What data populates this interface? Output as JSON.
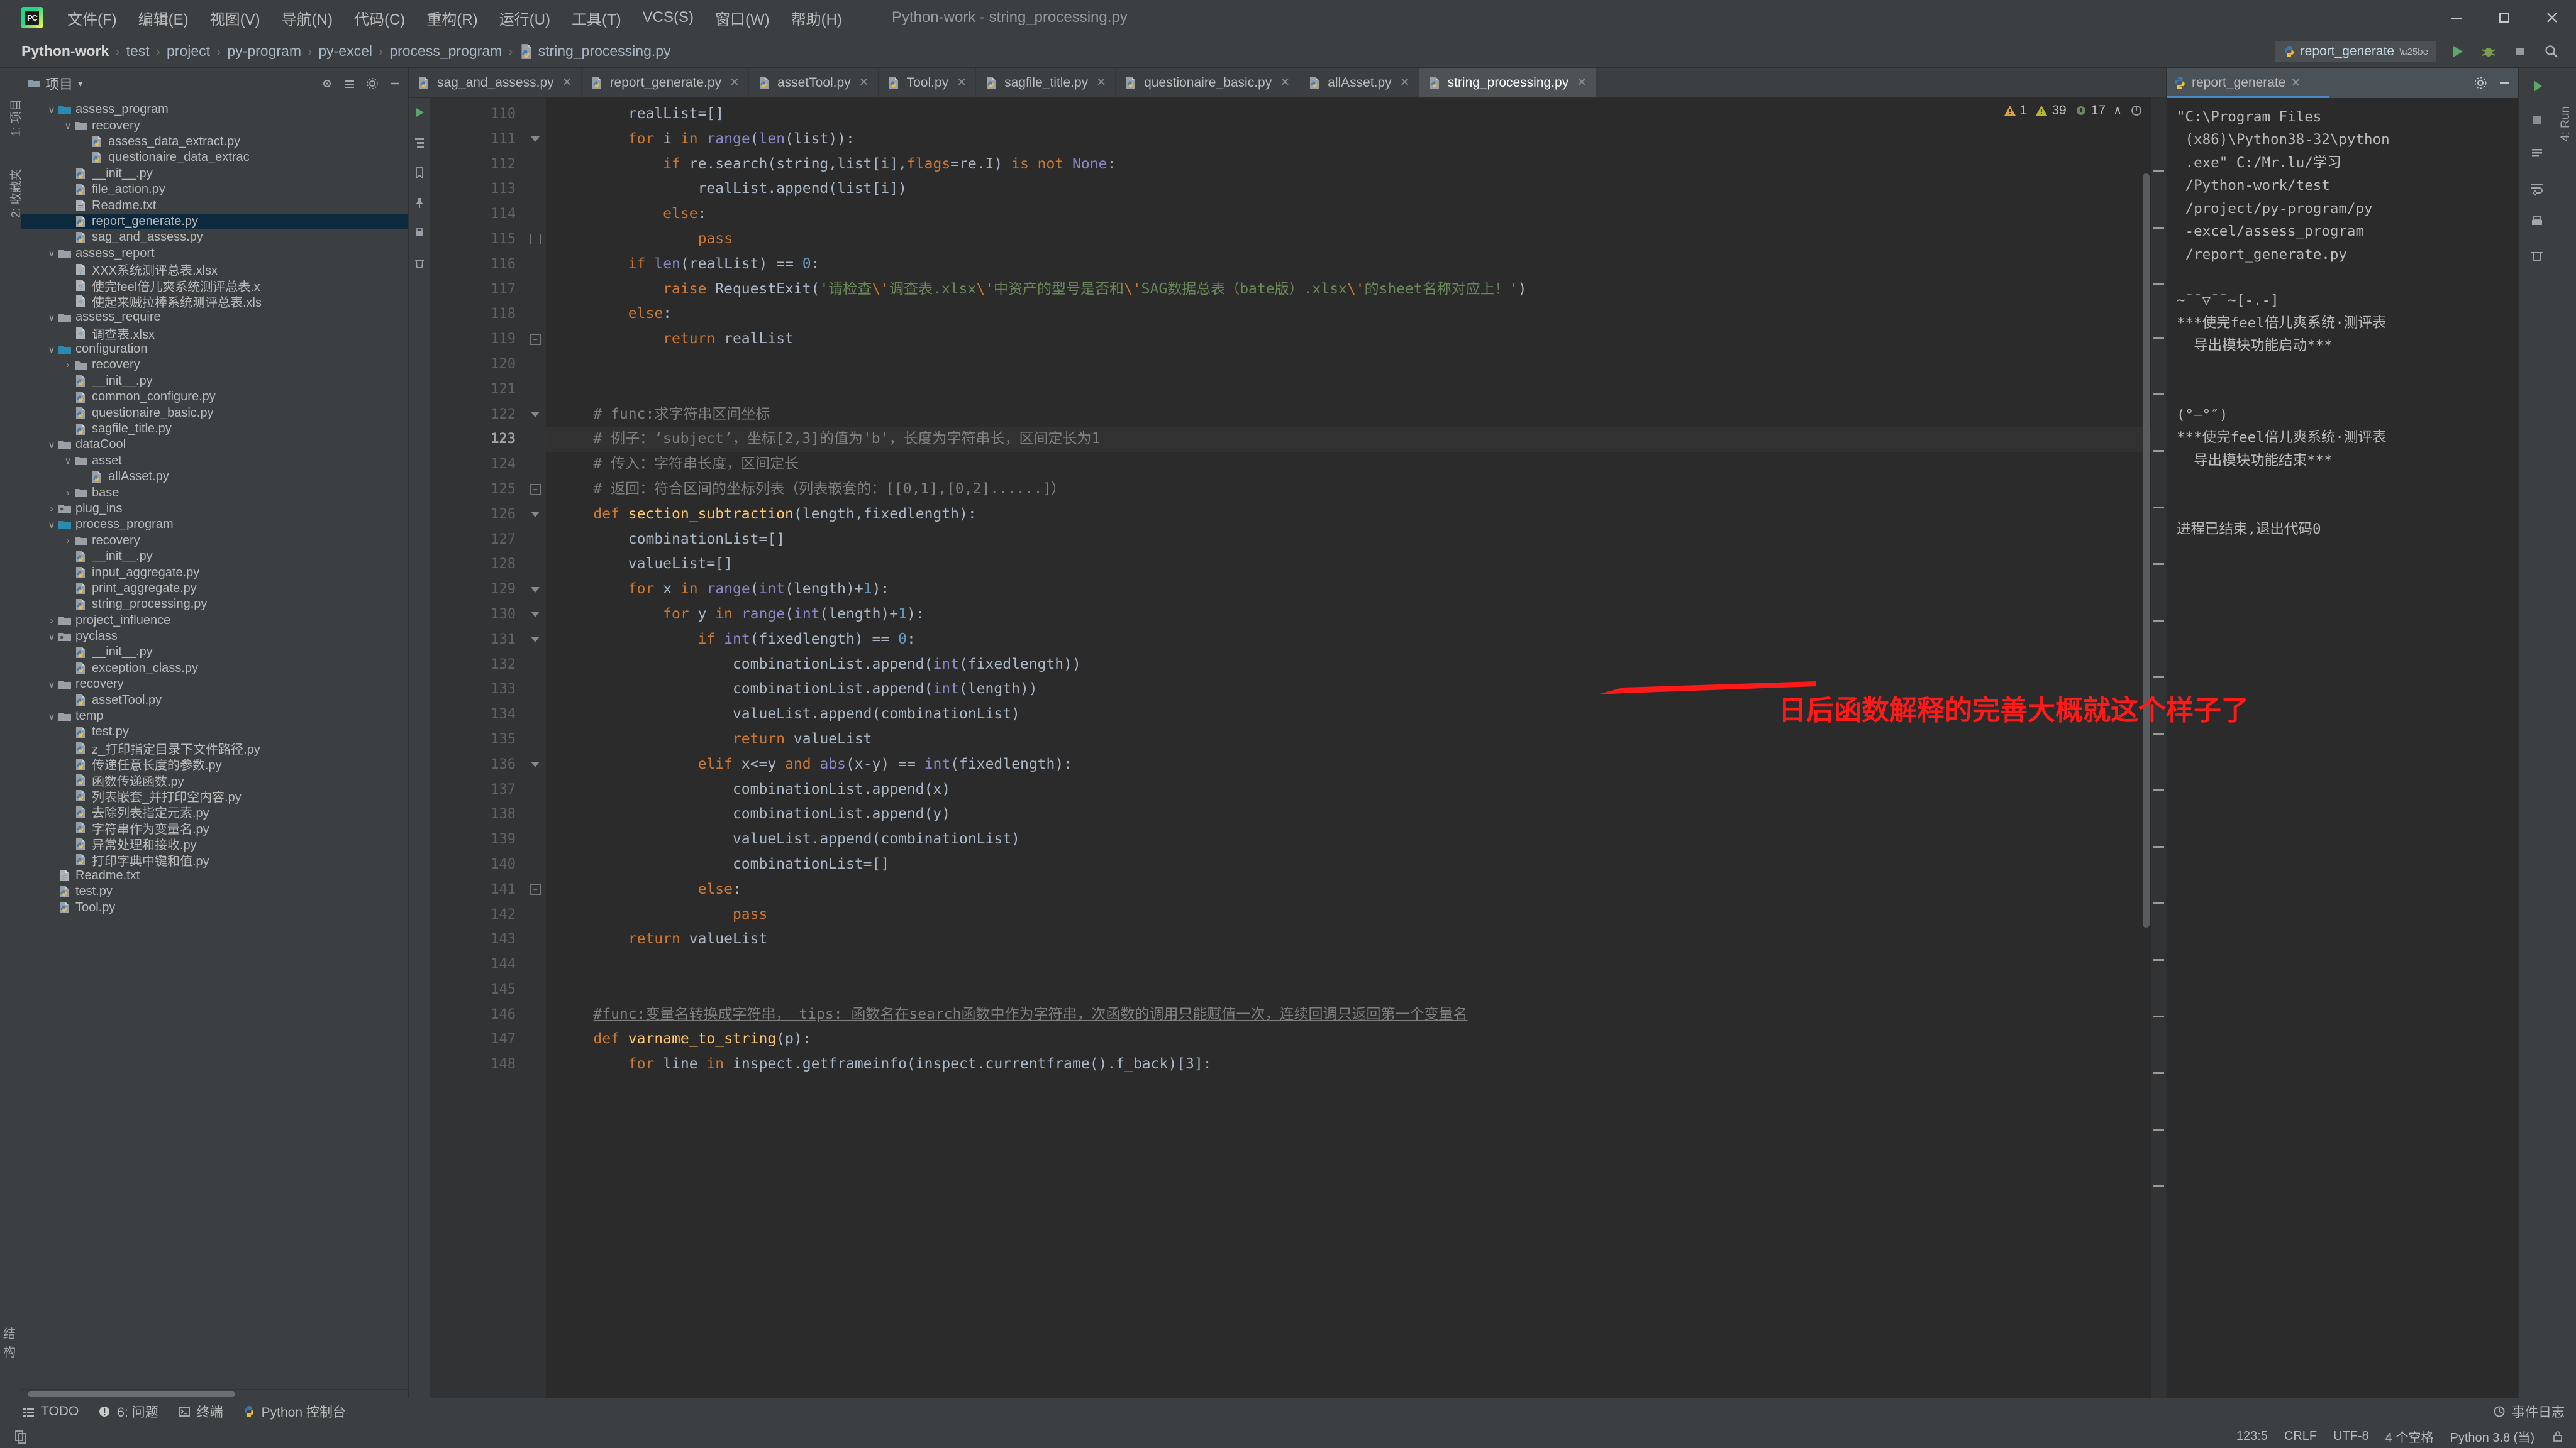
{
  "window": {
    "title": "Python-work - string_processing.py",
    "logo_text": "PC",
    "controls": {
      "minimize": "–",
      "maximize": "☐",
      "close": "✕"
    }
  },
  "menu": [
    {
      "label": "文件(F)",
      "name": "menu-file"
    },
    {
      "label": "编辑(E)",
      "name": "menu-edit"
    },
    {
      "label": "视图(V)",
      "name": "menu-view"
    },
    {
      "label": "导航(N)",
      "name": "menu-navigate"
    },
    {
      "label": "代码(C)",
      "name": "menu-code"
    },
    {
      "label": "重构(R)",
      "name": "menu-refactor"
    },
    {
      "label": "运行(U)",
      "name": "menu-run"
    },
    {
      "label": "工具(T)",
      "name": "menu-tools"
    },
    {
      "label": "VCS(S)",
      "name": "menu-vcs"
    },
    {
      "label": "窗口(W)",
      "name": "menu-window"
    },
    {
      "label": "帮助(H)",
      "name": "menu-help"
    }
  ],
  "breadcrumb": [
    "Python-work",
    "test",
    "project",
    "py-program",
    "py-excel",
    "process_program",
    "string_processing.py"
  ],
  "toolbar": {
    "run_config": "report_generate",
    "run_tooltip": "Run",
    "debug_tooltip": "Debug",
    "stop_tooltip": "Stop",
    "search_tooltip": "Search"
  },
  "project_panel": {
    "title": "项目",
    "dropdown": "▾",
    "tree": [
      {
        "depth": 3,
        "chev": "v",
        "icon": "folder-blue",
        "label": "assess_program",
        "selected": false
      },
      {
        "depth": 4,
        "chev": "v",
        "icon": "folder",
        "label": "recovery",
        "selected": false
      },
      {
        "depth": 5,
        "chev": "",
        "icon": "py",
        "label": "assess_data_extract.py",
        "selected": false
      },
      {
        "depth": 5,
        "chev": "",
        "icon": "py",
        "label": "questionaire_data_extrac",
        "selected": false
      },
      {
        "depth": 4,
        "chev": "",
        "icon": "py",
        "label": "__init__.py",
        "selected": false
      },
      {
        "depth": 4,
        "chev": "",
        "icon": "py",
        "label": "file_action.py",
        "selected": false
      },
      {
        "depth": 4,
        "chev": "",
        "icon": "txt",
        "label": "Readme.txt",
        "selected": false
      },
      {
        "depth": 4,
        "chev": "",
        "icon": "py",
        "label": "report_generate.py",
        "selected": true
      },
      {
        "depth": 4,
        "chev": "",
        "icon": "py",
        "label": "sag_and_assess.py",
        "selected": false
      },
      {
        "depth": 3,
        "chev": "v",
        "icon": "folder",
        "label": "assess_report",
        "selected": false
      },
      {
        "depth": 4,
        "chev": "",
        "icon": "unknown",
        "label": "XXX系统测评总表.xlsx",
        "selected": false
      },
      {
        "depth": 4,
        "chev": "",
        "icon": "unknown",
        "label": "使完feel倍儿爽系统测评总表.x",
        "selected": false
      },
      {
        "depth": 4,
        "chev": "",
        "icon": "unknown",
        "label": "使起来贼拉棒系统测评总表.xls",
        "selected": false
      },
      {
        "depth": 3,
        "chev": "v",
        "icon": "folder",
        "label": "assess_require",
        "selected": false
      },
      {
        "depth": 4,
        "chev": "",
        "icon": "unknown",
        "label": "调查表.xlsx",
        "selected": false
      },
      {
        "depth": 3,
        "chev": "v",
        "icon": "folder-blue",
        "label": "configuration",
        "selected": false
      },
      {
        "depth": 4,
        "chev": ">",
        "icon": "folder",
        "label": "recovery",
        "selected": false
      },
      {
        "depth": 4,
        "chev": "",
        "icon": "py",
        "label": "__init__.py",
        "selected": false
      },
      {
        "depth": 4,
        "chev": "",
        "icon": "py",
        "label": "common_configure.py",
        "selected": false
      },
      {
        "depth": 4,
        "chev": "",
        "icon": "py",
        "label": "questionaire_basic.py",
        "selected": false
      },
      {
        "depth": 4,
        "chev": "",
        "icon": "py",
        "label": "sagfile_title.py",
        "selected": false
      },
      {
        "depth": 3,
        "chev": "v",
        "icon": "folder",
        "label": "dataCool",
        "selected": false
      },
      {
        "depth": 4,
        "chev": "v",
        "icon": "folder",
        "label": "asset",
        "selected": false
      },
      {
        "depth": 5,
        "chev": "",
        "icon": "py",
        "label": "allAsset.py",
        "selected": false
      },
      {
        "depth": 4,
        "chev": ">",
        "icon": "folder",
        "label": "base",
        "selected": false
      },
      {
        "depth": 3,
        "chev": ">",
        "icon": "folder-pkg",
        "label": "plug_ins",
        "selected": false
      },
      {
        "depth": 3,
        "chev": "v",
        "icon": "folder-blue",
        "label": "process_program",
        "selected": false
      },
      {
        "depth": 4,
        "chev": ">",
        "icon": "folder",
        "label": "recovery",
        "selected": false
      },
      {
        "depth": 4,
        "chev": "",
        "icon": "py",
        "label": "__init__.py",
        "selected": false
      },
      {
        "depth": 4,
        "chev": "",
        "icon": "py",
        "label": "input_aggregate.py",
        "selected": false
      },
      {
        "depth": 4,
        "chev": "",
        "icon": "py",
        "label": "print_aggregate.py",
        "selected": false
      },
      {
        "depth": 4,
        "chev": "",
        "icon": "py",
        "label": "string_processing.py",
        "selected": false
      },
      {
        "depth": 3,
        "chev": ">",
        "icon": "folder",
        "label": "project_influence",
        "selected": false
      },
      {
        "depth": 3,
        "chev": "v",
        "icon": "folder-pkg",
        "label": "pyclass",
        "selected": false
      },
      {
        "depth": 4,
        "chev": "",
        "icon": "py",
        "label": "__init__.py",
        "selected": false
      },
      {
        "depth": 4,
        "chev": "",
        "icon": "py",
        "label": "exception_class.py",
        "selected": false
      },
      {
        "depth": 3,
        "chev": "v",
        "icon": "folder",
        "label": "recovery",
        "selected": false
      },
      {
        "depth": 4,
        "chev": "",
        "icon": "py",
        "label": "assetTool.py",
        "selected": false
      },
      {
        "depth": 3,
        "chev": "v",
        "icon": "folder",
        "label": "temp",
        "selected": false
      },
      {
        "depth": 4,
        "chev": "",
        "icon": "py",
        "label": "test.py",
        "selected": false
      },
      {
        "depth": 4,
        "chev": "",
        "icon": "py",
        "label": "z_打印指定目录下文件路径.py",
        "selected": false
      },
      {
        "depth": 4,
        "chev": "",
        "icon": "py",
        "label": "传递任意长度的参数.py",
        "selected": false
      },
      {
        "depth": 4,
        "chev": "",
        "icon": "py",
        "label": "函数传递函数.py",
        "selected": false
      },
      {
        "depth": 4,
        "chev": "",
        "icon": "py",
        "label": "列表嵌套_并打印空内容.py",
        "selected": false
      },
      {
        "depth": 4,
        "chev": "",
        "icon": "py",
        "label": "去除列表指定元素.py",
        "selected": false
      },
      {
        "depth": 4,
        "chev": "",
        "icon": "py",
        "label": "字符串作为变量名.py",
        "selected": false
      },
      {
        "depth": 4,
        "chev": "",
        "icon": "py",
        "label": "异常处理和接收.py",
        "selected": false
      },
      {
        "depth": 4,
        "chev": "",
        "icon": "py",
        "label": "打印字典中键和值.py",
        "selected": false
      },
      {
        "depth": 3,
        "chev": "",
        "icon": "txt",
        "label": "Readme.txt",
        "selected": false
      },
      {
        "depth": 3,
        "chev": "",
        "icon": "py",
        "label": "test.py",
        "selected": false
      },
      {
        "depth": 3,
        "chev": "",
        "icon": "py",
        "label": "Tool.py",
        "selected": false
      }
    ]
  },
  "left_strip": {
    "tab1": "1: 项目",
    "tab2": "2: 收藏夹",
    "bottom": "结构"
  },
  "editor_tabs": [
    {
      "label": "sag_and_assess.py",
      "active": false
    },
    {
      "label": "report_generate.py",
      "active": false
    },
    {
      "label": "assetTool.py",
      "active": false
    },
    {
      "label": "Tool.py",
      "active": false
    },
    {
      "label": "sagfile_title.py",
      "active": false
    },
    {
      "label": "questionaire_basic.py",
      "active": false
    },
    {
      "label": "allAsset.py",
      "active": false
    },
    {
      "label": "string_processing.py",
      "active": true
    }
  ],
  "inspection": {
    "errors": "1",
    "warnings": "39",
    "weak": "17",
    "chevron": "∧"
  },
  "code": {
    "first_line": 110,
    "current_line": 123,
    "lines": [
      {
        "n": 110,
        "fold": "",
        "html": "        <span class='def'>realList</span>=[]"
      },
      {
        "n": 111,
        "fold": "tri",
        "html": "        <span class='kw'>for</span> i <span class='kw'>in</span> <span class='bi'>range</span>(<span class='bi'>len</span>(list)):"
      },
      {
        "n": 112,
        "fold": "",
        "html": "            <span class='kw'>if</span> re.search(string,list[i],<span class='kw'>flags</span>=re.I) <span class='kw'>is not</span> <span class='bi'>None</span>:"
      },
      {
        "n": 113,
        "fold": "",
        "html": "                realList.append(list[i])"
      },
      {
        "n": 114,
        "fold": "",
        "html": "            <span class='kw'>else</span>:"
      },
      {
        "n": 115,
        "fold": "box",
        "html": "                <span class='kw'>pass</span>"
      },
      {
        "n": 116,
        "fold": "",
        "html": "        <span class='kw'>if</span> <span class='bi'>len</span>(realList) == <span class='num'>0</span>:"
      },
      {
        "n": 117,
        "fold": "",
        "html": "            <span class='kw'>raise</span> RequestExit(<span class='str'>'请检查</span><span class='esc'>\\'</span><span class='str'>调查表.xlsx</span><span class='esc'>\\'</span><span class='str'>中资产的型号是否和</span><span class='esc'>\\'</span><span class='str'>SAG数据总表（bate版）.xlsx</span><span class='esc'>\\'</span><span class='str'>的sheet名称对应上！'</span>)"
      },
      {
        "n": 118,
        "fold": "",
        "html": "        <span class='kw'>else</span>:"
      },
      {
        "n": 119,
        "fold": "box",
        "html": "            <span class='kw'>return</span> realList"
      },
      {
        "n": 120,
        "fold": "",
        "html": ""
      },
      {
        "n": 121,
        "fold": "",
        "html": ""
      },
      {
        "n": 122,
        "fold": "tri",
        "html": "    <span class='cmt'># func:求字符串区间坐标</span>"
      },
      {
        "n": 123,
        "fold": "",
        "html": "    <span class='cmt'># 例子：‘subject’，坐标[2,3]的值为'b'，长度为字符串长，区间定长为1</span>"
      },
      {
        "n": 124,
        "fold": "",
        "html": "    <span class='cmt'># 传入：字符串长度，区间定长</span>"
      },
      {
        "n": 125,
        "fold": "box",
        "html": "    <span class='cmt'># 返回：符合区间的坐标列表（列表嵌套的：[[0,1],[0,2]......]）</span>"
      },
      {
        "n": 126,
        "fold": "tri",
        "html": "    <span class='kw'>def</span> <span class='fn'>section_subtraction</span>(length,<span class='err-u'>fixedlength</span>):"
      },
      {
        "n": 127,
        "fold": "",
        "html": "        <span class='def'>combinationList</span>=[]"
      },
      {
        "n": 128,
        "fold": "",
        "html": "        <span class='def'>valueList</span>=[]"
      },
      {
        "n": 129,
        "fold": "tri",
        "html": "        <span class='kw'>for</span> x <span class='kw'>in</span> <span class='bi'>range</span>(<span class='bi'>int</span>(length)+<span class='num'>1</span>):"
      },
      {
        "n": 130,
        "fold": "tri",
        "html": "            <span class='kw'>for</span> y <span class='kw'>in</span> <span class='bi'>range</span>(<span class='bi'>int</span>(length)+<span class='num'>1</span>):"
      },
      {
        "n": 131,
        "fold": "tri",
        "html": "                <span class='kw'>if</span> <span class='bi'>int</span>(fixedlength) == <span class='num'>0</span>:"
      },
      {
        "n": 132,
        "fold": "",
        "html": "                    combinationList.append(<span class='bi'>int</span>(fixedlength))"
      },
      {
        "n": 133,
        "fold": "",
        "html": "                    combinationList.append(<span class='bi'>int</span>(length))"
      },
      {
        "n": 134,
        "fold": "",
        "html": "                    valueList.append(combinationList)"
      },
      {
        "n": 135,
        "fold": "",
        "html": "                    <span class='kw'>return</span> valueList"
      },
      {
        "n": 136,
        "fold": "tri",
        "html": "                <span class='kw'>elif</span> <span class='err-u'>x&lt;=y</span> <span class='kw'>and</span> <span class='bi'>abs</span>(x-y) == <span class='bi'>int</span>(fixedlength):"
      },
      {
        "n": 137,
        "fold": "",
        "html": "                    combinationList.append(x)"
      },
      {
        "n": 138,
        "fold": "",
        "html": "                    combinationList.append(y)"
      },
      {
        "n": 139,
        "fold": "",
        "html": "                    valueList.append(combinationList)"
      },
      {
        "n": 140,
        "fold": "",
        "html": "                    <span class='def'>combinationList</span>=[]"
      },
      {
        "n": 141,
        "fold": "box",
        "html": "                <span class='kw'>else</span>:"
      },
      {
        "n": 142,
        "fold": "",
        "html": "                    <span class='kw'>pass</span>"
      },
      {
        "n": 143,
        "fold": "",
        "html": "        <span class='kw'>return</span> valueList"
      },
      {
        "n": 144,
        "fold": "",
        "html": ""
      },
      {
        "n": 145,
        "fold": "",
        "html": ""
      },
      {
        "n": 146,
        "fold": "",
        "html": "    <span class='cmt warn-line'>#func:变量名转换成字符串， tips: 函数名在search函数中作为字符串，次函数的调用只能赋值一次，连续回调只返回第一个变量名</span>"
      },
      {
        "n": 147,
        "fold": "",
        "html": "    <span class='kw'>def</span> <span class='fn err-u'>varname_to_string</span>(p):"
      },
      {
        "n": 148,
        "fold": "",
        "html": "        <span class='kw'>for</span> line <span class='kw'>in</span> inspect.getframeinfo(inspect.currentframe().f_back)[3]:"
      }
    ]
  },
  "annotation": {
    "text": "日后函数解释的完善大概就这个样子了",
    "color": "#ff1a1a"
  },
  "run_panel": {
    "label": "Run:",
    "tab": "report_generate",
    "close": "✕",
    "side_tab": "4: Run",
    "output": [
      "\"C:\\Program Files",
      " (x86)\\Python38-32\\python",
      " .exe\" C:/Mr.lu/学习",
      " /Python-work/test",
      " /project/py-program/py",
      " -excel/assess_program",
      " /report_generate.py",
      "",
      "~¯¯▽¯¯~[-.-]",
      "***使完feel倍儿爽系统·测评表",
      "  导出模块功能启动***",
      "",
      "",
      "(°—°″)",
      "***使完feel倍儿爽系统·测评表",
      "  导出模块功能结束***",
      "",
      "",
      "进程已结束,退出代码0"
    ]
  },
  "bottom_bar": {
    "items": [
      {
        "label": "TODO",
        "icon": "todo-icon"
      },
      {
        "label": "6: 问题",
        "icon": "problems-icon"
      },
      {
        "label": "终端",
        "icon": "terminal-icon"
      },
      {
        "label": "Python 控制台",
        "icon": "python-console-icon"
      }
    ],
    "right_label": "事件日志"
  },
  "status_bar": {
    "caret": "123:5",
    "line_ending": "CRLF",
    "encoding": "UTF-8",
    "indent": "4 个空格",
    "interpreter": "Python 3.8 (当)",
    "lock": "🔒"
  },
  "colors": {
    "chrome": "#3c3f41",
    "editor_bg": "#2b2b2b",
    "gutter_bg": "#313335",
    "selection": "#0d293e",
    "accent_blue": "#4a88c7",
    "annotation_red": "#ff1a1a",
    "keyword": "#cc7832",
    "string": "#6a8759",
    "number": "#6897bb",
    "function": "#ffc66d",
    "comment": "#808080",
    "text": "#a9b7c6"
  }
}
